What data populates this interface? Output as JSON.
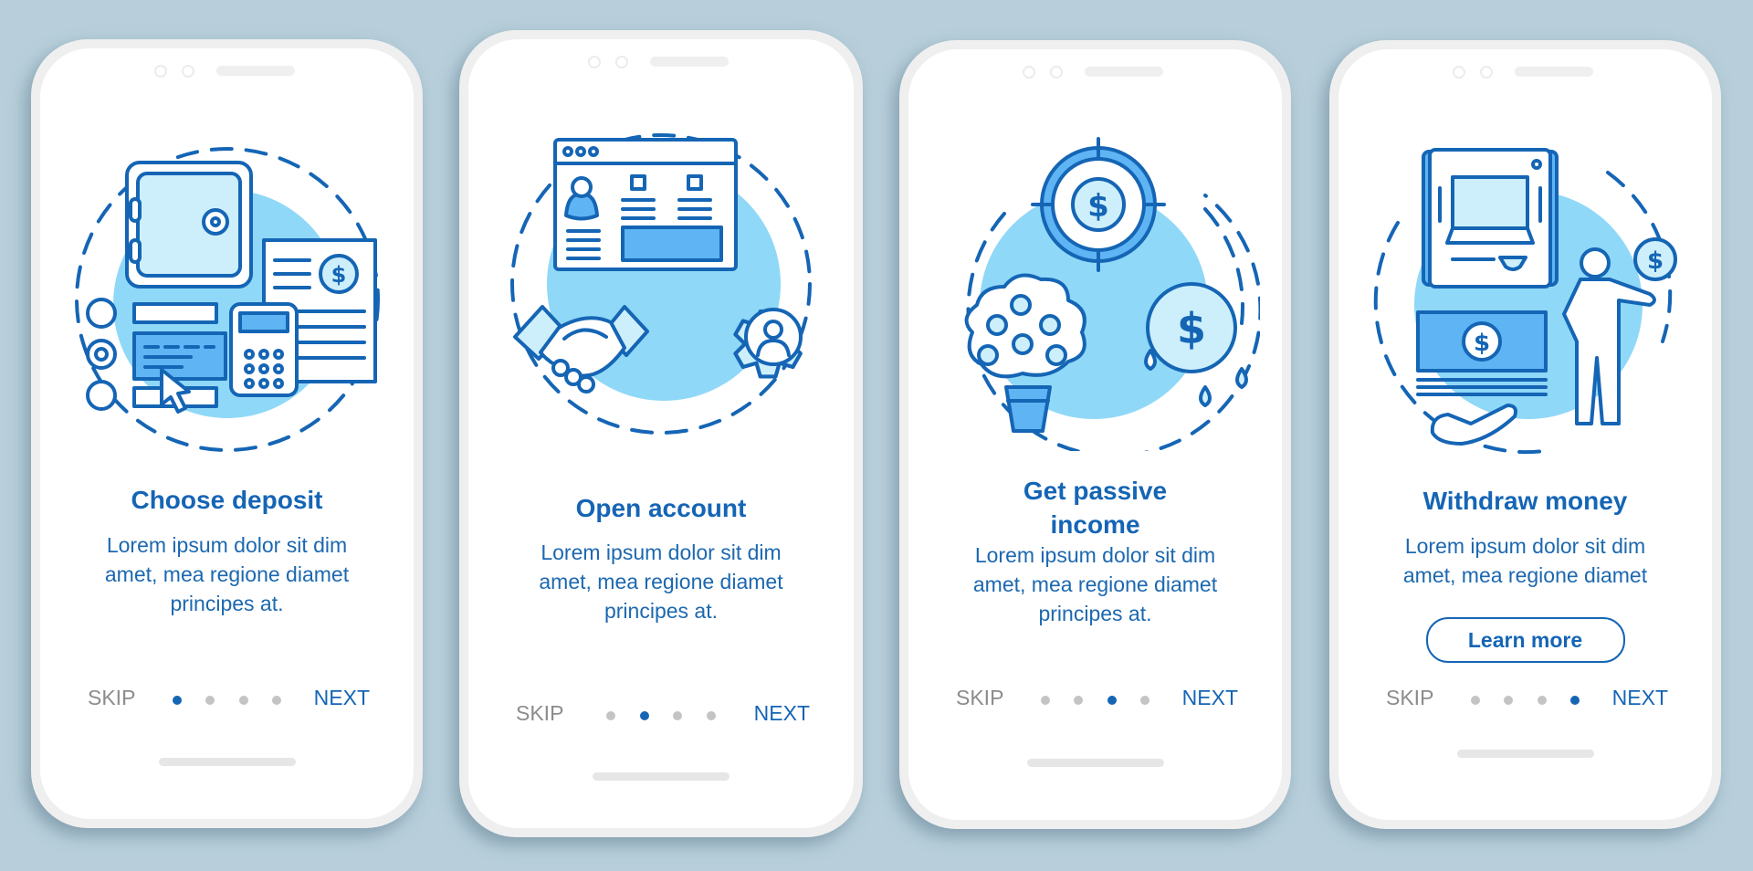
{
  "colors": {
    "background": "#b8cfdb",
    "accent": "#1565b5",
    "illustration_fill": "#8fd8f8",
    "dot_inactive": "#c4c4c4",
    "skip_text": "#8c8c8c"
  },
  "screens": [
    {
      "illustration": "safe-deposit-calculator-form-icon",
      "title": "Choose deposit",
      "body": [
        "Lorem ipsum dolor sit dim",
        "amet, mea regione diamet",
        "principes at."
      ],
      "skip_label": "SKIP",
      "next_label": "NEXT",
      "page_index": 1,
      "page_count": 4
    },
    {
      "illustration": "browser-handshake-gear-icon",
      "title": "Open account",
      "body": [
        "Lorem ipsum dolor sit dim",
        "amet, mea regione diamet",
        "principes at."
      ],
      "skip_label": "SKIP",
      "next_label": "NEXT",
      "page_index": 2,
      "page_count": 4
    },
    {
      "illustration": "money-tree-target-coin-icon",
      "title_lines": [
        "Get passive",
        "income"
      ],
      "body": [
        "Lorem ipsum dolor sit dim",
        "amet, mea regione diamet",
        "principes at."
      ],
      "skip_label": "SKIP",
      "next_label": "NEXT",
      "page_index": 3,
      "page_count": 4
    },
    {
      "illustration": "atm-cash-person-icon",
      "title": "Withdraw money",
      "body": [
        "Lorem ipsum dolor sit dim",
        "amet, mea regione diamet"
      ],
      "button_label": "Learn more",
      "skip_label": "SKIP",
      "next_label": "NEXT",
      "page_index": 4,
      "page_count": 4
    }
  ],
  "icon_glyphs": {
    "dollar": "$"
  }
}
